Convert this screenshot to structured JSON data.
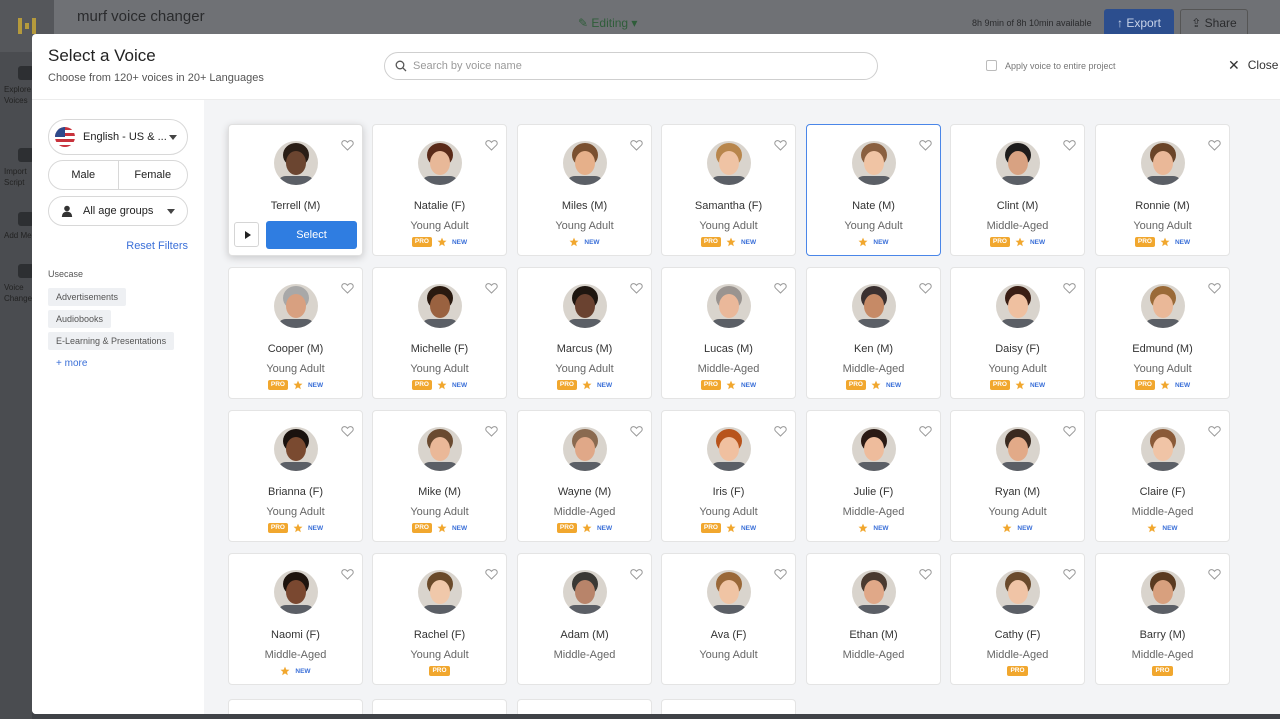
{
  "app": {
    "title": "murf voice changer",
    "status": "Editing",
    "usage": "8h 9min of 8h 10min available",
    "export_label": "Export",
    "share_label": "Share",
    "sidebar": [
      "Explore Voices",
      "Import Script",
      "Add Media",
      "Voice Changer"
    ]
  },
  "modal": {
    "title": "Select a Voice",
    "subtitle": "Choose from 120+ voices in 20+ Languages",
    "search_placeholder": "Search by voice name",
    "apply_label": "Apply voice to entire project",
    "close_label": "Close"
  },
  "filters": {
    "language": "English - US & ...",
    "gender_options": [
      "Male",
      "Female"
    ],
    "age": "All age groups",
    "reset": "Reset Filters",
    "usecase_label": "Usecase",
    "usecases": [
      "Advertisements",
      "Audiobooks",
      "E-Learning & Presentations"
    ],
    "more": "+ more"
  },
  "select_label": "Select",
  "voices": [
    {
      "name": "Terrell (M)",
      "age": "",
      "pro": false,
      "new": false,
      "skin": "#6b4530",
      "hair": "#2a1e16"
    },
    {
      "name": "Natalie (F)",
      "age": "Young Adult",
      "pro": true,
      "new": true,
      "skin": "#e8b898",
      "hair": "#5a2a18"
    },
    {
      "name": "Miles (M)",
      "age": "Young Adult",
      "pro": false,
      "new": true,
      "skin": "#e6b08a",
      "hair": "#7a5030"
    },
    {
      "name": "Samantha (F)",
      "age": "Young Adult",
      "pro": true,
      "new": true,
      "skin": "#efc3a4",
      "hair": "#b8864c"
    },
    {
      "name": "Nate (M)",
      "age": "Young Adult",
      "pro": false,
      "new": true,
      "skin": "#f0c4a4",
      "hair": "#8a6040"
    },
    {
      "name": "Clint (M)",
      "age": "Middle-Aged",
      "pro": true,
      "new": true,
      "skin": "#d8a282",
      "hair": "#1e1c1c"
    },
    {
      "name": "Ronnie (M)",
      "age": "Young Adult",
      "pro": true,
      "new": true,
      "skin": "#eab898",
      "hair": "#6a4428"
    },
    {
      "name": "Cooper (M)",
      "age": "Young Adult",
      "pro": true,
      "new": true,
      "skin": "#d8a080",
      "hair": "#a8a8a8"
    },
    {
      "name": "Michelle (F)",
      "age": "Young Adult",
      "pro": true,
      "new": true,
      "skin": "#9a6240",
      "hair": "#2a1a10"
    },
    {
      "name": "Marcus (M)",
      "age": "Young Adult",
      "pro": true,
      "new": true,
      "skin": "#6a4230",
      "hair": "#1e1610"
    },
    {
      "name": "Lucas (M)",
      "age": "Middle-Aged",
      "pro": true,
      "new": true,
      "skin": "#eab89a",
      "hair": "#9a9490"
    },
    {
      "name": "Ken (M)",
      "age": "Middle-Aged",
      "pro": true,
      "new": true,
      "skin": "#c68a66",
      "hair": "#3a3030"
    },
    {
      "name": "Daisy (F)",
      "age": "Young Adult",
      "pro": true,
      "new": true,
      "skin": "#efc0a0",
      "hair": "#3a1e14"
    },
    {
      "name": "Edmund (M)",
      "age": "Young Adult",
      "pro": true,
      "new": true,
      "skin": "#eab898",
      "hair": "#9a6a38"
    },
    {
      "name": "Brianna (F)",
      "age": "Young Adult",
      "pro": true,
      "new": true,
      "skin": "#7a4a30",
      "hair": "#1a120e"
    },
    {
      "name": "Mike (M)",
      "age": "Young Adult",
      "pro": true,
      "new": true,
      "skin": "#eab898",
      "hair": "#6a4a30"
    },
    {
      "name": "Wayne (M)",
      "age": "Middle-Aged",
      "pro": true,
      "new": true,
      "skin": "#e0a888",
      "hair": "#8a6a50"
    },
    {
      "name": "Iris (F)",
      "age": "Young Adult",
      "pro": true,
      "new": true,
      "skin": "#f0c0a0",
      "hair": "#b8541c"
    },
    {
      "name": "Julie (F)",
      "age": "Middle-Aged",
      "pro": false,
      "new": true,
      "skin": "#eebc9c",
      "hair": "#2a1a14"
    },
    {
      "name": "Ryan (M)",
      "age": "Young Adult",
      "pro": false,
      "new": true,
      "skin": "#e2aa88",
      "hair": "#3a2a20"
    },
    {
      "name": "Claire (F)",
      "age": "Middle-Aged",
      "pro": false,
      "new": true,
      "skin": "#f0c4a6",
      "hair": "#8a5a38"
    },
    {
      "name": "Naomi (F)",
      "age": "Middle-Aged",
      "pro": false,
      "new": true,
      "skin": "#7a4830",
      "hair": "#1e140e"
    },
    {
      "name": "Rachel (F)",
      "age": "Young Adult",
      "pro": true,
      "new": false,
      "skin": "#f0c8aa",
      "hair": "#6a4a2a"
    },
    {
      "name": "Adam (M)",
      "age": "Middle-Aged",
      "pro": false,
      "new": false,
      "skin": "#b8846a",
      "hair": "#3a3834"
    },
    {
      "name": "Ava (F)",
      "age": "Young Adult",
      "pro": false,
      "new": false,
      "skin": "#f0c4a4",
      "hair": "#9a6838"
    },
    {
      "name": "Ethan (M)",
      "age": "Middle-Aged",
      "pro": false,
      "new": false,
      "skin": "#e0a888",
      "hair": "#4a3a30"
    },
    {
      "name": "Cathy (F)",
      "age": "Middle-Aged",
      "pro": true,
      "new": false,
      "skin": "#f0c4a6",
      "hair": "#6a4a2c"
    },
    {
      "name": "Barry (M)",
      "age": "Middle-Aged",
      "pro": true,
      "new": false,
      "skin": "#d8a07e",
      "hair": "#5a3a20"
    }
  ],
  "colors": {
    "accent": "#2f7de1",
    "pro_badge": "#f1a72e",
    "new_text": "#3a6fd8",
    "star": "#f1a72e"
  }
}
